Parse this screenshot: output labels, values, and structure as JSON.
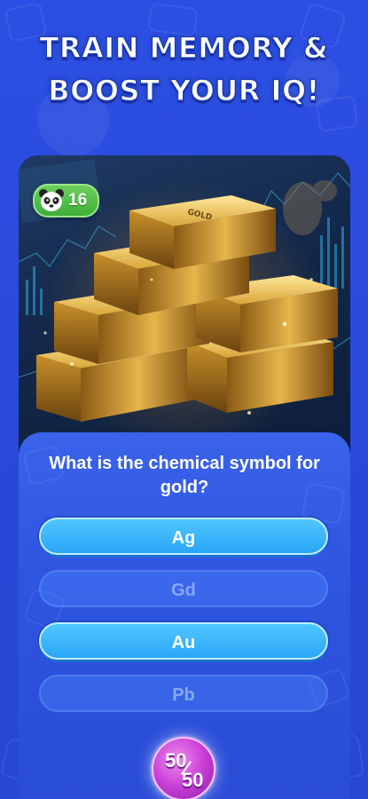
{
  "headline": {
    "line1": "TRAIN MEMORY &",
    "line2": "BOOST YOUR IQ!"
  },
  "badge": {
    "icon": "panda-icon",
    "count": "16"
  },
  "hero_image": {
    "gold_bar_text": "GOLD"
  },
  "quiz": {
    "question": "What is the chemical symbol for gold?",
    "answers": [
      {
        "label": "Ag",
        "state": "active"
      },
      {
        "label": "Gd",
        "state": "dim"
      },
      {
        "label": "Au",
        "state": "active"
      },
      {
        "label": "Pb",
        "state": "dim"
      }
    ],
    "hint_button": {
      "top": "50",
      "bottom": "50"
    }
  },
  "colors": {
    "background": "#2647d8",
    "answer_active": "#2aa6f7",
    "badge": "#3fae39",
    "hint": "#c93fd6"
  }
}
